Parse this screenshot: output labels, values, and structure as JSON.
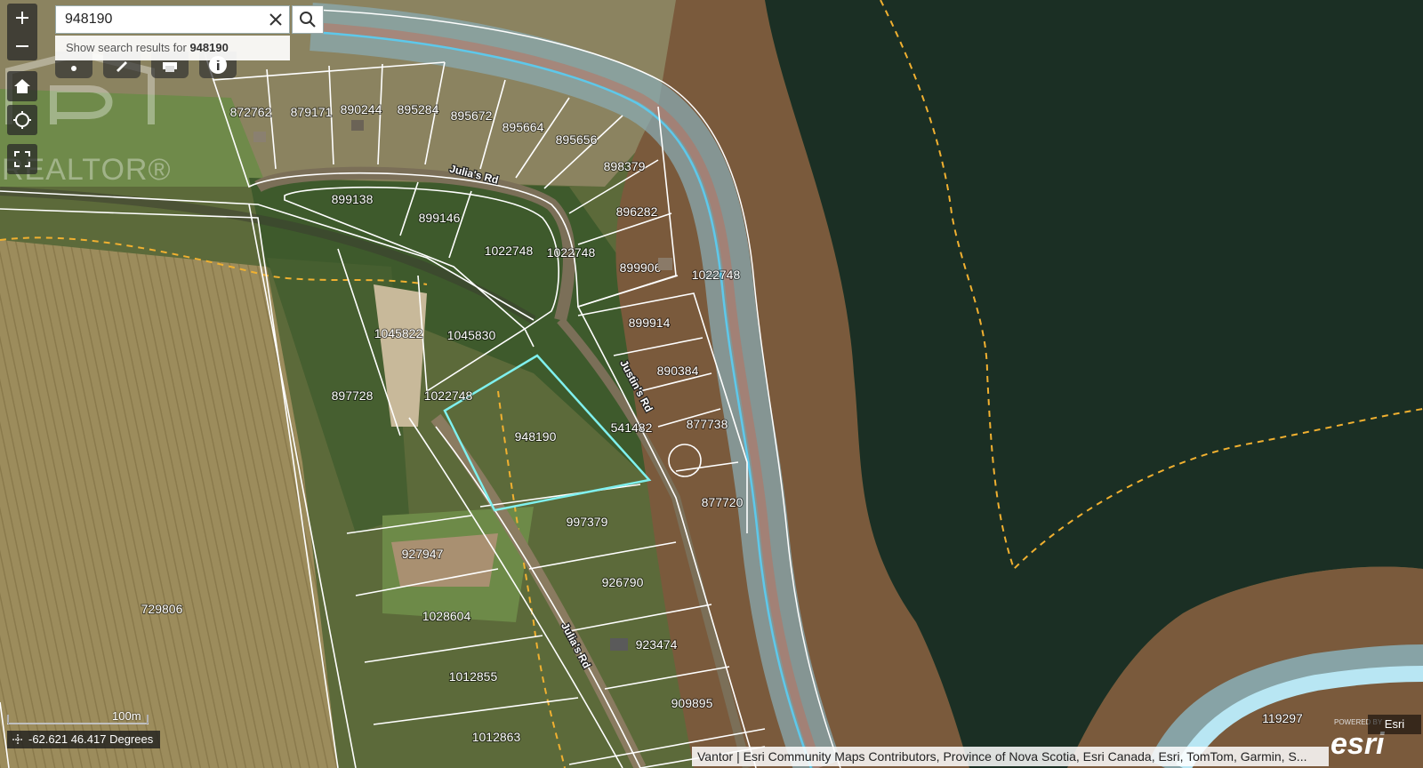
{
  "search": {
    "value": "948190",
    "suggestion_prefix": "Show search results for ",
    "suggestion_term": "948190"
  },
  "watermark": {
    "text": "REALTOR®"
  },
  "parcels": [
    {
      "id": "872762"
    },
    {
      "id": "879171"
    },
    {
      "id": "890244"
    },
    {
      "id": "895284"
    },
    {
      "id": "895672"
    },
    {
      "id": "895664"
    },
    {
      "id": "895656"
    },
    {
      "id": "898379"
    },
    {
      "id": "896282"
    },
    {
      "id": "899138"
    },
    {
      "id": "899146"
    },
    {
      "id": "1022748"
    },
    {
      "id": "1022748"
    },
    {
      "id": "899906"
    },
    {
      "id": "1022748"
    },
    {
      "id": "899914"
    },
    {
      "id": "1045822"
    },
    {
      "id": "1045830"
    },
    {
      "id": "890384"
    },
    {
      "id": "897728"
    },
    {
      "id": "1022748"
    },
    {
      "id": "948190"
    },
    {
      "id": "541482"
    },
    {
      "id": "877738"
    },
    {
      "id": "877720"
    },
    {
      "id": "997379"
    },
    {
      "id": "927947"
    },
    {
      "id": "926790"
    },
    {
      "id": "729806"
    },
    {
      "id": "1028604"
    },
    {
      "id": "923474"
    },
    {
      "id": "1012855"
    },
    {
      "id": "909895"
    },
    {
      "id": "1012863"
    },
    {
      "id": "119297"
    }
  ],
  "roads": [
    {
      "name": "Julia's Rd"
    },
    {
      "name": "Justin's Rd"
    },
    {
      "name": "Julia's Rd"
    }
  ],
  "highlighted_parcel": "948190",
  "scale_bar": {
    "label": "100m"
  },
  "coordinates": {
    "text": "-62.621 46.417 Degrees"
  },
  "attribution": {
    "text": "Vantor | Esri Community Maps Contributors, Province of Nova Scotia, Esri Canada, Esri, TomTom, Garmin, S..."
  },
  "esri": {
    "badge": "Esri",
    "powered": "POWERED BY",
    "logo": "esri"
  },
  "colors": {
    "highlight": "#7ff0ee",
    "water": "#1b2f24",
    "floodplain": "#7a5a3c",
    "river": "#9fd8ef",
    "parcel_line": "#ffffff",
    "boundary_dash": "#f0b030"
  },
  "icons": [
    "plus-icon",
    "minus-icon",
    "home-icon",
    "locate-icon",
    "fullscreen-icon",
    "search-icon",
    "close-icon",
    "measure-icon",
    "draw-icon",
    "print-icon",
    "info-icon"
  ]
}
